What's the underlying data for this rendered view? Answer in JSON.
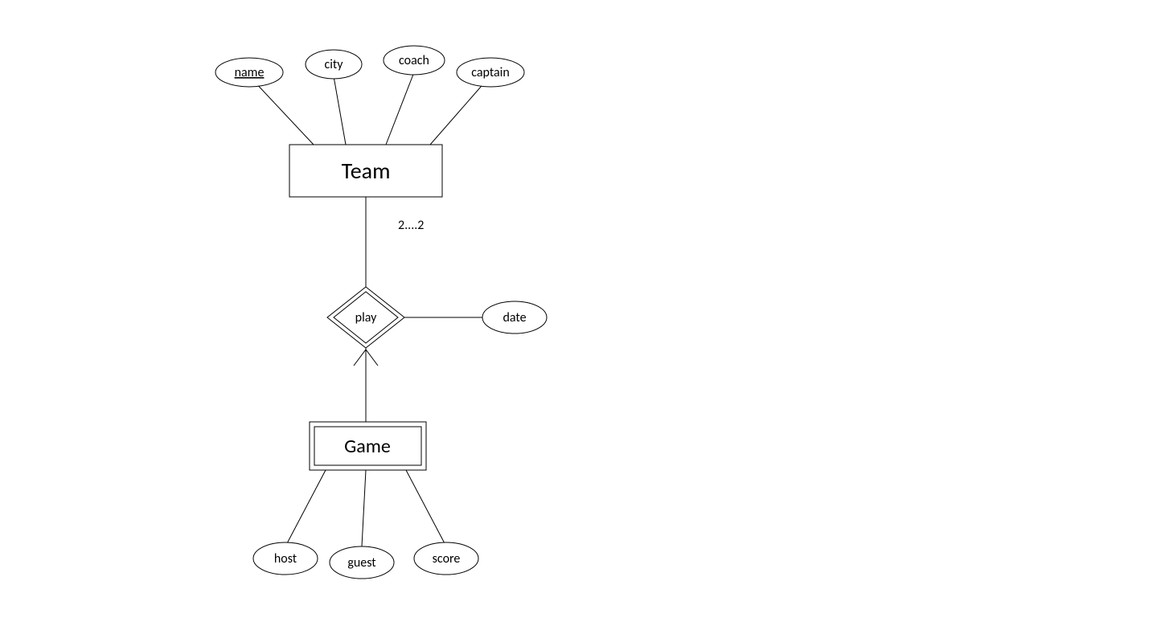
{
  "diagram": {
    "entities": {
      "team": "Team",
      "game": "Game"
    },
    "attributes": {
      "name": "name",
      "city": "city",
      "coach": "coach",
      "captain": "captain",
      "host": "host",
      "guest": "guest",
      "score": "score",
      "date": "date"
    },
    "relationship": {
      "play": "play"
    },
    "cardinality": {
      "team_play": "2....2"
    }
  }
}
